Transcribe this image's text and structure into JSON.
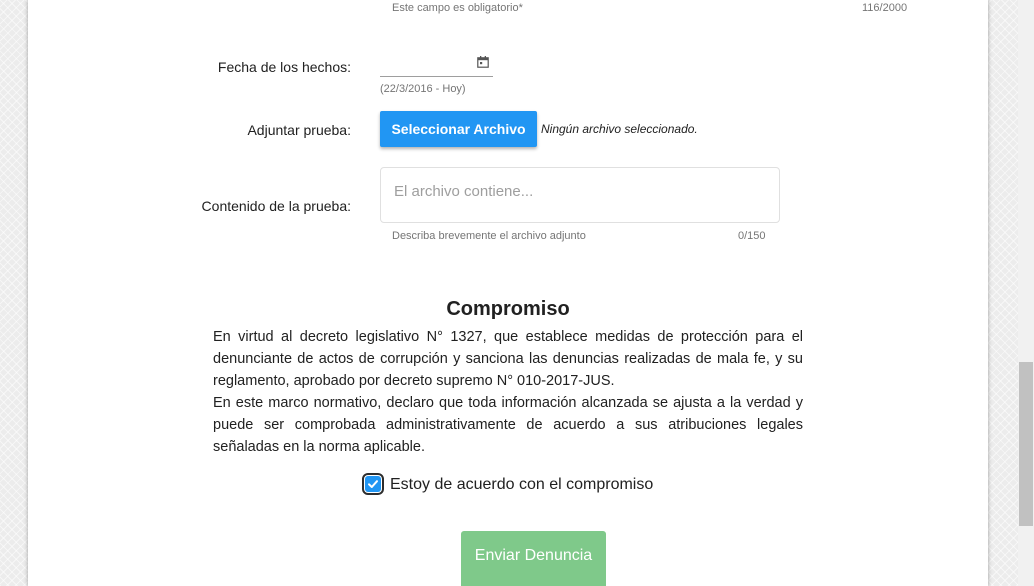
{
  "top": {
    "required_hint": "Este campo es obligatorio*",
    "char_count": "116/2000"
  },
  "date_field": {
    "label": "Fecha de los hechos:",
    "range_hint": "(22/3/2016 - Hoy)",
    "icon": "calendar-icon"
  },
  "attachment": {
    "label": "Adjuntar prueba:",
    "button_label": "Seleccionar Archivo",
    "status": "Ningún archivo seleccionado."
  },
  "content_field": {
    "label": "Contenido de la prueba:",
    "placeholder": "El archivo contiene...",
    "helper": "Describa brevemente el archivo adjunto",
    "counter": "0/150"
  },
  "commitment": {
    "title": "Compromiso",
    "paragraph1": "En virtud al decreto legislativo N° 1327, que establece medidas de protección para el denunciante de actos de corrupción y sanciona las denuncias realizadas de mala fe, y su reglamento, aprobado por decreto supremo N° 010-2017-JUS.",
    "paragraph2": "En este marco normativo, declaro que toda información alcanzada se ajusta a la verdad y puede ser comprobada administrativamente de acuerdo a sus atribuciones legales señaladas en la norma aplicable.",
    "checkbox_label": "Estoy de acuerdo con el compromiso",
    "checked": true
  },
  "submit": {
    "label": "Enviar Denuncia"
  },
  "colors": {
    "primary": "#2196f3",
    "submit_disabled": "#7fc98a"
  }
}
